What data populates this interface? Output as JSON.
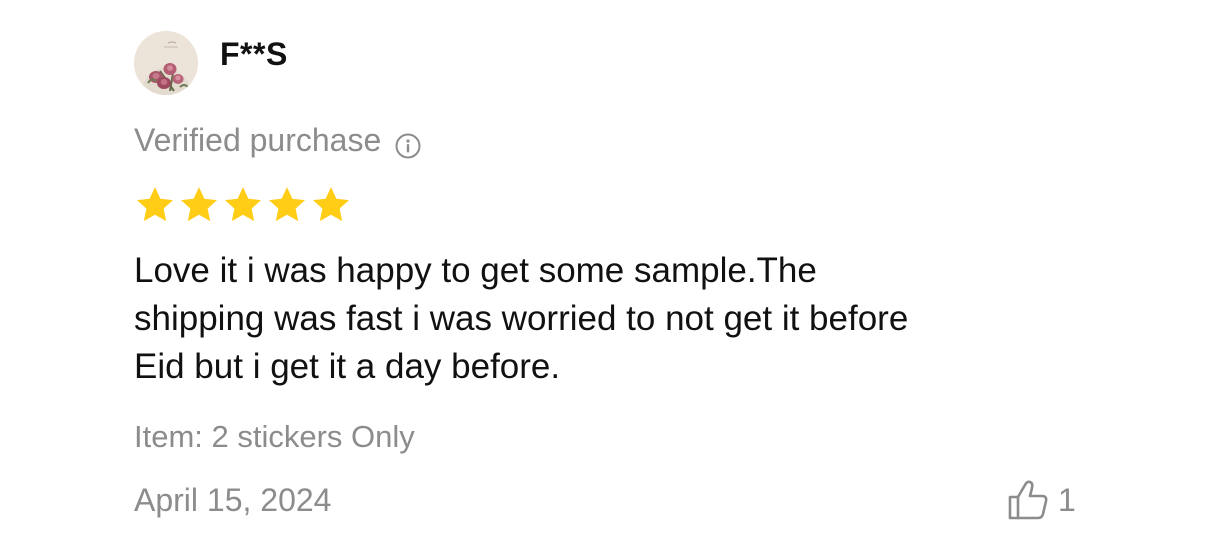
{
  "review": {
    "user": {
      "name": "F**S",
      "avatar_icon": "rose-bouquet-avatar"
    },
    "verified_label": "Verified purchase",
    "info_icon": "info-circle-icon",
    "rating": {
      "value": 5,
      "max": 5,
      "star_color": "#ffcc16"
    },
    "text": "Love it i was happy to get some sample.The\nshipping was fast i was worried to not get it before\nEid but i get it a day before.",
    "item_label": "Item: 2 stickers Only",
    "date": "April 15, 2024",
    "helpful": {
      "icon": "thumbs-up-icon",
      "count": "1"
    },
    "colors": {
      "muted_text": "#8c8c8c",
      "body_text": "#111111"
    }
  }
}
